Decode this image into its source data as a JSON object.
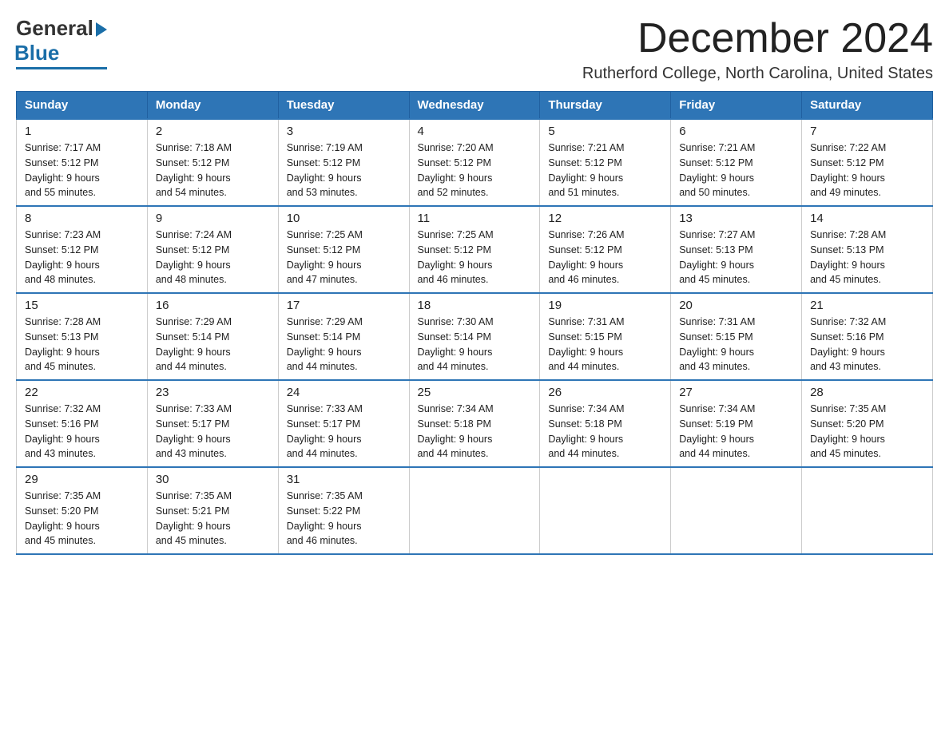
{
  "logo": {
    "general": "General",
    "blue": "Blue"
  },
  "title": "December 2024",
  "subtitle": "Rutherford College, North Carolina, United States",
  "days_of_week": [
    "Sunday",
    "Monday",
    "Tuesday",
    "Wednesday",
    "Thursday",
    "Friday",
    "Saturday"
  ],
  "weeks": [
    [
      {
        "num": "1",
        "sunrise": "7:17 AM",
        "sunset": "5:12 PM",
        "daylight": "9 hours and 55 minutes."
      },
      {
        "num": "2",
        "sunrise": "7:18 AM",
        "sunset": "5:12 PM",
        "daylight": "9 hours and 54 minutes."
      },
      {
        "num": "3",
        "sunrise": "7:19 AM",
        "sunset": "5:12 PM",
        "daylight": "9 hours and 53 minutes."
      },
      {
        "num": "4",
        "sunrise": "7:20 AM",
        "sunset": "5:12 PM",
        "daylight": "9 hours and 52 minutes."
      },
      {
        "num": "5",
        "sunrise": "7:21 AM",
        "sunset": "5:12 PM",
        "daylight": "9 hours and 51 minutes."
      },
      {
        "num": "6",
        "sunrise": "7:21 AM",
        "sunset": "5:12 PM",
        "daylight": "9 hours and 50 minutes."
      },
      {
        "num": "7",
        "sunrise": "7:22 AM",
        "sunset": "5:12 PM",
        "daylight": "9 hours and 49 minutes."
      }
    ],
    [
      {
        "num": "8",
        "sunrise": "7:23 AM",
        "sunset": "5:12 PM",
        "daylight": "9 hours and 48 minutes."
      },
      {
        "num": "9",
        "sunrise": "7:24 AM",
        "sunset": "5:12 PM",
        "daylight": "9 hours and 48 minutes."
      },
      {
        "num": "10",
        "sunrise": "7:25 AM",
        "sunset": "5:12 PM",
        "daylight": "9 hours and 47 minutes."
      },
      {
        "num": "11",
        "sunrise": "7:25 AM",
        "sunset": "5:12 PM",
        "daylight": "9 hours and 46 minutes."
      },
      {
        "num": "12",
        "sunrise": "7:26 AM",
        "sunset": "5:12 PM",
        "daylight": "9 hours and 46 minutes."
      },
      {
        "num": "13",
        "sunrise": "7:27 AM",
        "sunset": "5:13 PM",
        "daylight": "9 hours and 45 minutes."
      },
      {
        "num": "14",
        "sunrise": "7:28 AM",
        "sunset": "5:13 PM",
        "daylight": "9 hours and 45 minutes."
      }
    ],
    [
      {
        "num": "15",
        "sunrise": "7:28 AM",
        "sunset": "5:13 PM",
        "daylight": "9 hours and 45 minutes."
      },
      {
        "num": "16",
        "sunrise": "7:29 AM",
        "sunset": "5:14 PM",
        "daylight": "9 hours and 44 minutes."
      },
      {
        "num": "17",
        "sunrise": "7:29 AM",
        "sunset": "5:14 PM",
        "daylight": "9 hours and 44 minutes."
      },
      {
        "num": "18",
        "sunrise": "7:30 AM",
        "sunset": "5:14 PM",
        "daylight": "9 hours and 44 minutes."
      },
      {
        "num": "19",
        "sunrise": "7:31 AM",
        "sunset": "5:15 PM",
        "daylight": "9 hours and 44 minutes."
      },
      {
        "num": "20",
        "sunrise": "7:31 AM",
        "sunset": "5:15 PM",
        "daylight": "9 hours and 43 minutes."
      },
      {
        "num": "21",
        "sunrise": "7:32 AM",
        "sunset": "5:16 PM",
        "daylight": "9 hours and 43 minutes."
      }
    ],
    [
      {
        "num": "22",
        "sunrise": "7:32 AM",
        "sunset": "5:16 PM",
        "daylight": "9 hours and 43 minutes."
      },
      {
        "num": "23",
        "sunrise": "7:33 AM",
        "sunset": "5:17 PM",
        "daylight": "9 hours and 43 minutes."
      },
      {
        "num": "24",
        "sunrise": "7:33 AM",
        "sunset": "5:17 PM",
        "daylight": "9 hours and 44 minutes."
      },
      {
        "num": "25",
        "sunrise": "7:34 AM",
        "sunset": "5:18 PM",
        "daylight": "9 hours and 44 minutes."
      },
      {
        "num": "26",
        "sunrise": "7:34 AM",
        "sunset": "5:18 PM",
        "daylight": "9 hours and 44 minutes."
      },
      {
        "num": "27",
        "sunrise": "7:34 AM",
        "sunset": "5:19 PM",
        "daylight": "9 hours and 44 minutes."
      },
      {
        "num": "28",
        "sunrise": "7:35 AM",
        "sunset": "5:20 PM",
        "daylight": "9 hours and 45 minutes."
      }
    ],
    [
      {
        "num": "29",
        "sunrise": "7:35 AM",
        "sunset": "5:20 PM",
        "daylight": "9 hours and 45 minutes."
      },
      {
        "num": "30",
        "sunrise": "7:35 AM",
        "sunset": "5:21 PM",
        "daylight": "9 hours and 45 minutes."
      },
      {
        "num": "31",
        "sunrise": "7:35 AM",
        "sunset": "5:22 PM",
        "daylight": "9 hours and 46 minutes."
      },
      null,
      null,
      null,
      null
    ]
  ]
}
